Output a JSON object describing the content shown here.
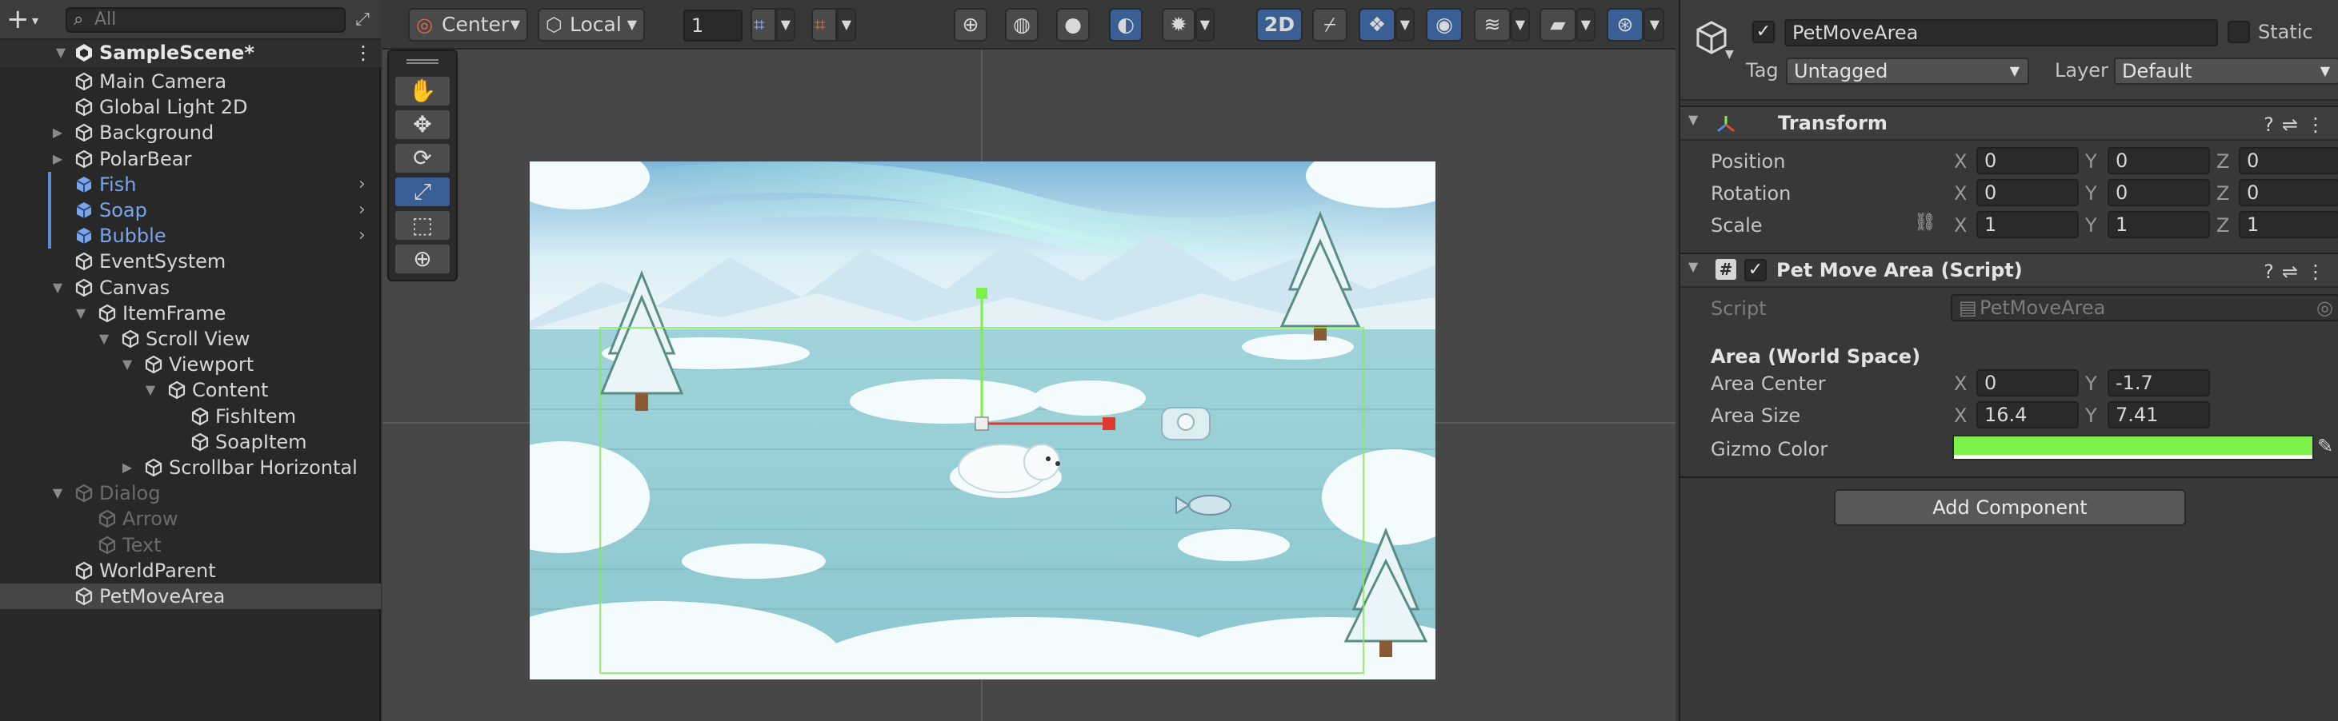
{
  "hierarchy": {
    "search_placeholder": "All",
    "scene_name": "SampleScene*",
    "items": [
      {
        "label": "Main Camera"
      },
      {
        "label": "Global Light 2D"
      },
      {
        "label": "Background"
      },
      {
        "label": "PolarBear"
      },
      {
        "label": "Fish"
      },
      {
        "label": "Soap"
      },
      {
        "label": "Bubble"
      },
      {
        "label": "EventSystem"
      },
      {
        "label": "Canvas"
      },
      {
        "label": "ItemFrame"
      },
      {
        "label": "Scroll View"
      },
      {
        "label": "Viewport"
      },
      {
        "label": "Content"
      },
      {
        "label": "FishItem"
      },
      {
        "label": "SoapItem"
      },
      {
        "label": "Scrollbar Horizontal"
      },
      {
        "label": "Dialog"
      },
      {
        "label": "Arrow"
      },
      {
        "label": "Text"
      },
      {
        "label": "WorldParent"
      },
      {
        "label": "PetMoveArea"
      }
    ]
  },
  "scene_toolbar": {
    "pivot": "Center",
    "space": "Local",
    "grid_size": "1",
    "mode_2d": "2D"
  },
  "inspector": {
    "object_name": "PetMoveArea",
    "static_label": "Static",
    "tag_label": "Tag",
    "tag_value": "Untagged",
    "layer_label": "Layer",
    "layer_value": "Default",
    "transform": {
      "title": "Transform",
      "position_label": "Position",
      "rotation_label": "Rotation",
      "scale_label": "Scale",
      "position": {
        "x": "0",
        "y": "0",
        "z": "0"
      },
      "rotation": {
        "x": "0",
        "y": "0",
        "z": "0"
      },
      "scale": {
        "x": "1",
        "y": "1",
        "z": "1"
      }
    },
    "script_component": {
      "title": "Pet Move Area (Script)",
      "script_label": "Script",
      "script_value": "PetMoveArea",
      "section_header": "Area (World Space)",
      "area_center_label": "Area Center",
      "area_center": {
        "x": "0",
        "y": "-1.7"
      },
      "area_size_label": "Area Size",
      "area_size": {
        "x": "16.4",
        "y": "7.41"
      },
      "gizmo_color_label": "Gizmo Color",
      "gizmo_color": "#7ef04a"
    },
    "add_component": "Add Component",
    "axis_x": "X",
    "axis_y": "Y",
    "axis_z": "Z"
  },
  "colors": {
    "selection_blue": "#3a5f94",
    "prefab_blue": "#7aa5ea",
    "gizmo_green": "#7ef04a",
    "handle_red": "#e03a2e"
  }
}
